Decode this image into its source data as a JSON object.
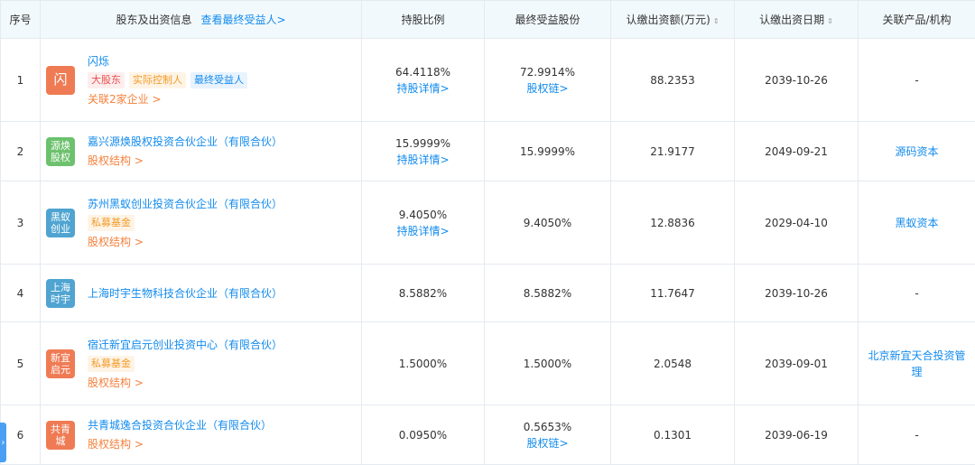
{
  "header": {
    "col_index": "序号",
    "col_shareholder": "股东及出资信息",
    "view_beneficiary": "查看最终受益人>",
    "col_ratio": "持股比例",
    "col_final_share": "最终受益股份",
    "col_amount": "认缴出资额(万元)",
    "col_date": "认缴出资日期",
    "col_related": "关联产品/机构",
    "sort_glyph": "⇕"
  },
  "rows": [
    {
      "index": "1",
      "logo_text": "闪",
      "logo_color": "#ef7b54",
      "name": "闪烁",
      "tags": [
        "大股东",
        "实际控制人",
        "最终受益人"
      ],
      "sub_link": "关联2家企业 >",
      "ratio": "64.4118%",
      "ratio_link": "持股详情>",
      "final_share": "72.9914%",
      "final_link": "股权链>",
      "amount": "88.2353",
      "date": "2039-10-26",
      "related": "-"
    },
    {
      "index": "2",
      "logo_text": "源焕股权",
      "logo_color": "#6cc16d",
      "name": "嘉兴源焕股权投资合伙企业（有限合伙）",
      "tags": [],
      "sub_link": "股权结构 >",
      "ratio": "15.9999%",
      "ratio_link": "持股详情>",
      "final_share": "15.9999%",
      "final_link": "",
      "amount": "21.9177",
      "date": "2049-09-21",
      "related": "源码资本"
    },
    {
      "index": "3",
      "logo_text": "黑蚁创业",
      "logo_color": "#4fa4d1",
      "name": "苏州黑蚁创业投资合伙企业（有限合伙）",
      "tags": [
        "私募基金"
      ],
      "sub_link": "股权结构 >",
      "ratio": "9.4050%",
      "ratio_link": "持股详情>",
      "final_share": "9.4050%",
      "final_link": "",
      "amount": "12.8836",
      "date": "2029-04-10",
      "related": "黑蚁资本"
    },
    {
      "index": "4",
      "logo_text": "上海时宇",
      "logo_color": "#4fa4d1",
      "name": "上海时宇生物科技合伙企业（有限合伙）",
      "tags": [],
      "sub_link": "",
      "ratio": "8.5882%",
      "ratio_link": "",
      "final_share": "8.5882%",
      "final_link": "",
      "amount": "11.7647",
      "date": "2039-10-26",
      "related": "-"
    },
    {
      "index": "5",
      "logo_text": "新宜启元",
      "logo_color": "#ef7b54",
      "name": "宿迁新宜启元创业投资中心（有限合伙）",
      "tags": [
        "私募基金"
      ],
      "sub_link": "股权结构 >",
      "ratio": "1.5000%",
      "ratio_link": "",
      "final_share": "1.5000%",
      "final_link": "",
      "amount": "2.0548",
      "date": "2039-09-01",
      "related": "北京新宜天合投资管理"
    },
    {
      "index": "6",
      "logo_text": "共青城",
      "logo_color": "#ef7b54",
      "name": "共青城逸合投资合伙企业（有限合伙）",
      "tags": [],
      "sub_link": "股权结构 >",
      "ratio": "0.0950%",
      "ratio_link": "",
      "final_share": "0.5653%",
      "final_link": "股权链>",
      "amount": "0.1301",
      "date": "2039-06-19",
      "related": "-"
    }
  ],
  "side_tab_glyph": "›"
}
